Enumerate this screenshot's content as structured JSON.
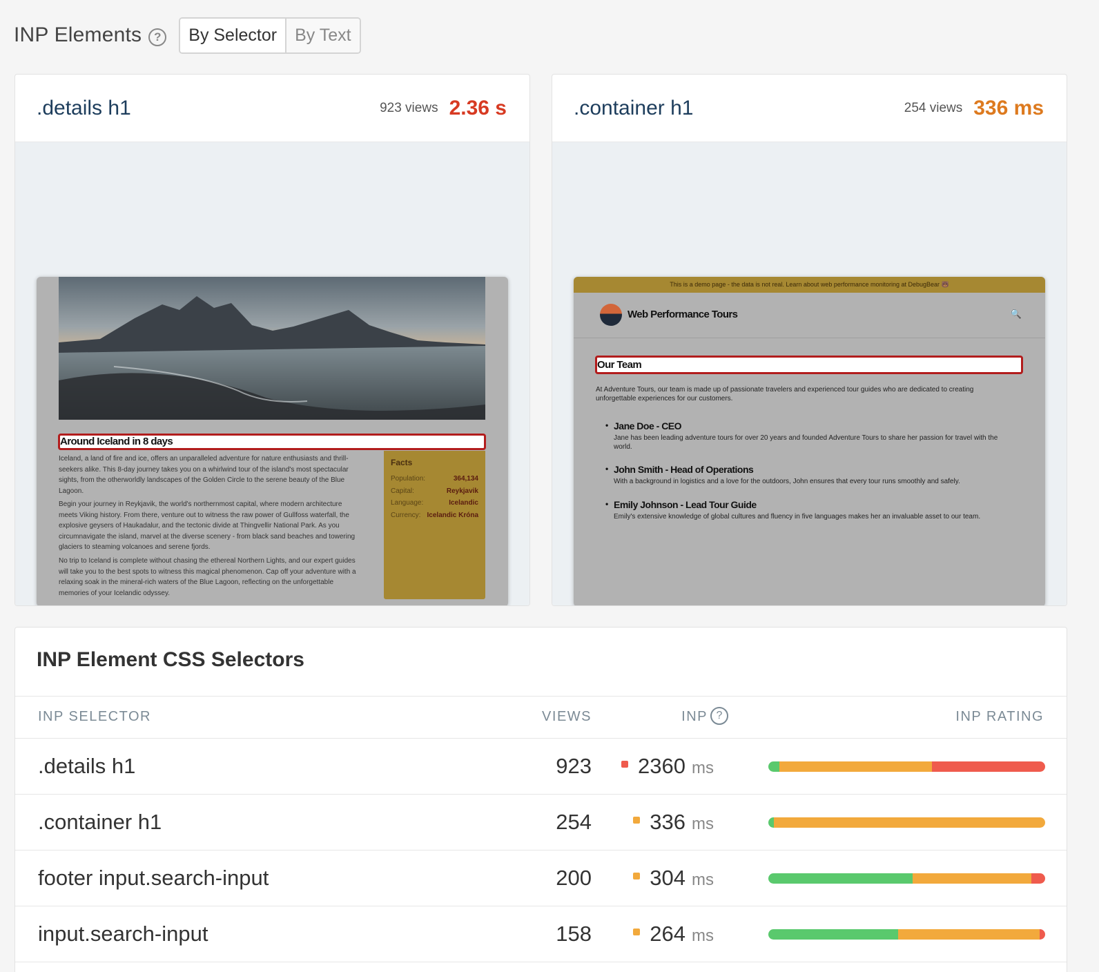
{
  "header": {
    "title": "INP Elements",
    "help": "?",
    "tabs": [
      {
        "label": "By Selector",
        "active": true
      },
      {
        "label": "By Text",
        "active": false
      }
    ]
  },
  "cards": [
    {
      "selector": ".details h1",
      "views": "923 views",
      "value": "2.36 s",
      "rating": "poor",
      "screenshot": {
        "heading": "Around Iceland in 8 days",
        "paragraphs": [
          "Iceland, a land of fire and ice, offers an unparalleled adventure for nature enthusiasts and thrill-seekers alike. This 8-day journey takes you on a whirlwind tour of the island's most spectacular sights, from the otherworldly landscapes of the Golden Circle to the serene beauty of the Blue Lagoon.",
          "Begin your journey in Reykjavik, the world's northernmost capital, where modern architecture meets Viking history. From there, venture out to witness the raw power of Gullfoss waterfall, the explosive geysers of Haukadalur, and the tectonic divide at Thingvellir National Park. As you circumnavigate the island, marvel at the diverse scenery - from black sand beaches and towering glaciers to steaming volcanoes and serene fjords.",
          "No trip to Iceland is complete without chasing the ethereal Northern Lights, and our expert guides will take you to the best spots to witness this magical phenomenon. Cap off your adventure with a relaxing soak in the mineral-rich waters of the Blue Lagoon, reflecting on the unforgettable memories of your Icelandic odyssey."
        ],
        "facts_title": "Facts",
        "facts": [
          {
            "key": "Population:",
            "value": "364,134"
          },
          {
            "key": "Capital:",
            "value": "Reykjavik"
          },
          {
            "key": "Language:",
            "value": "Icelandic"
          },
          {
            "key": "Currency:",
            "value": "Icelandic Króna"
          }
        ]
      }
    },
    {
      "selector": ".container h1",
      "views": "254 views",
      "value": "336 ms",
      "rating": "needs-improvement",
      "screenshot": {
        "banner": "This is a demo page - the data is not real. Learn about web performance monitoring at DebugBear 🐻",
        "site_name": "Web Performance Tours",
        "search_icon": "🔍",
        "heading": "Our Team",
        "intro": "At Adventure Tours, our team is made up of passionate travelers and experienced tour guides who are dedicated to creating unforgettable experiences for our customers.",
        "members": [
          {
            "name": "Jane Doe - CEO",
            "desc": "Jane has been leading adventure tours for over 20 years and founded Adventure Tours to share her passion for travel with the world."
          },
          {
            "name": "John Smith - Head of Operations",
            "desc": "With a background in logistics and a love for the outdoors, John ensures that every tour runs smoothly and safely."
          },
          {
            "name": "Emily Johnson - Lead Tour Guide",
            "desc": "Emily's extensive knowledge of global cultures and fluency in five languages makes her an invaluable asset to our team."
          }
        ]
      }
    }
  ],
  "table": {
    "title": "INP Element CSS Selectors",
    "columns": {
      "selector": "INP SELECTOR",
      "views": "VIEWS",
      "inp": "INP",
      "inp_help": "?",
      "rating": "INP RATING"
    },
    "unit": "ms",
    "rows": [
      {
        "selector": ".details h1",
        "views": "923",
        "inp": "2360",
        "status_color": "#ef5b4d",
        "dist": {
          "good": 0.04,
          "ni": 0.55,
          "poor": 0.41
        }
      },
      {
        "selector": ".container h1",
        "views": "254",
        "inp": "336",
        "status_color": "#f2a93c",
        "dist": {
          "good": 0.02,
          "ni": 0.98,
          "poor": 0.0
        }
      },
      {
        "selector": "footer input.search-input",
        "views": "200",
        "inp": "304",
        "status_color": "#f2a93c",
        "dist": {
          "good": 0.52,
          "ni": 0.43,
          "poor": 0.05
        }
      },
      {
        "selector": "input.search-input",
        "views": "158",
        "inp": "264",
        "status_color": "#f2a93c",
        "dist": {
          "good": 0.47,
          "ni": 0.51,
          "poor": 0.02
        }
      }
    ]
  },
  "colors": {
    "good": "#5ac96d",
    "needs_improvement": "#f2a93c",
    "poor": "#ef5b4d",
    "selector_text": "#1d3d5c"
  }
}
